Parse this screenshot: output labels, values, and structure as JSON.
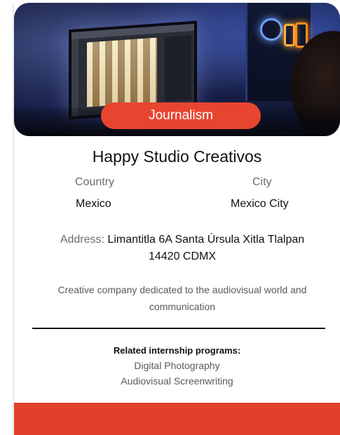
{
  "card": {
    "tag": "Journalism",
    "title": "Happy Studio Creativos",
    "country_label": "Country",
    "country_value": "Mexico",
    "city_label": "City",
    "city_value": "Mexico City",
    "address_label": "Address:",
    "address_value": "Limantitla 6A Santa Úrsula Xitla Tlalpan 14420 CDMX",
    "description": "Creative company dedicated to the audiovisual world and communication",
    "related_heading": "Related internship programs:",
    "related_programs": [
      "Digital Photography",
      "Audiovisual Screenwriting"
    ]
  },
  "colors": {
    "accent": "#e84530",
    "footer": "#e3402c"
  }
}
